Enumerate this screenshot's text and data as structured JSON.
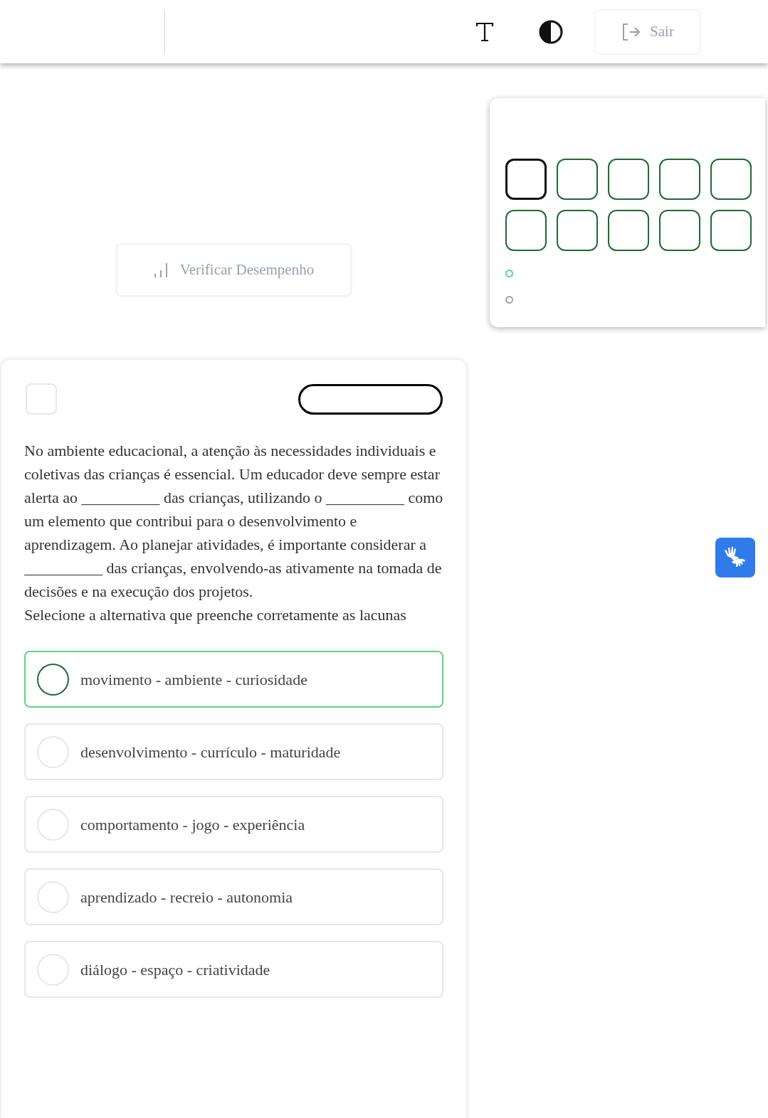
{
  "header": {
    "logout_button": {
      "label": "Sair",
      "disabled": true
    }
  },
  "performance_button": {
    "label": "Verificar Desempenho",
    "disabled": true
  },
  "question_nav": {
    "questions": [
      {
        "selected": true
      },
      {
        "selected": false
      },
      {
        "selected": false
      },
      {
        "selected": false
      },
      {
        "selected": false
      },
      {
        "selected": false
      },
      {
        "selected": false
      },
      {
        "selected": false
      },
      {
        "selected": false
      },
      {
        "selected": false
      }
    ],
    "legend": [
      {
        "color": "#4ade80"
      },
      {
        "color": "#9ca3af"
      }
    ]
  },
  "question": {
    "flag_checkbox": {
      "checked": false
    },
    "statement": "No ambiente educacional, a atenção às necessidades individuais e coletivas das crianças é essencial. Um educador deve sempre estar alerta ao __________ das crianças, utilizando o __________ como um elemento que contribui para o desenvolvimento e aprendizagem. Ao planejar atividades, é importante considerar a __________ das crianças, envolvendo-as ativamente na tomada de decisões e na execução dos projetos.",
    "prompt": "Selecione a alternativa que preenche corretamente as lacunas",
    "options": [
      {
        "text": "movimento - ambiente - curiosidade",
        "selected": true
      },
      {
        "text": "desenvolvimento - currículo - maturidade",
        "selected": false
      },
      {
        "text": "comportamento - jogo - experiência",
        "selected": false
      },
      {
        "text": "aprendizado - recreio - autonomia",
        "selected": false
      },
      {
        "text": "diálogo - espaço - criatividade",
        "selected": false
      }
    ]
  }
}
